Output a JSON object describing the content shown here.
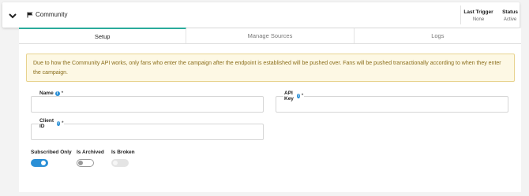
{
  "header": {
    "title": "Community",
    "last_trigger_label": "Last Trigger",
    "last_trigger_value": "None",
    "status_label": "Status",
    "status_value": "Active"
  },
  "tabs": [
    {
      "label": "Setup",
      "active": true
    },
    {
      "label": "Manage Sources",
      "active": false
    },
    {
      "label": "Logs",
      "active": false
    }
  ],
  "notice": "Due to how the Community API works, only fans who enter the campaign after the endpoint is established will be pushed over. Fans will be pushed transactionally according to when they enter the campaign.",
  "fields": {
    "name": {
      "label": "Name",
      "required": "*",
      "value": ""
    },
    "api_key": {
      "label": "API Key",
      "required": "*",
      "value": ""
    },
    "client_id": {
      "label": "Client ID",
      "required": "*",
      "value": ""
    }
  },
  "toggles": {
    "subscribed_only": {
      "label": "Subscribed Only",
      "on": true
    },
    "is_archived": {
      "label": "Is Archived",
      "on": false
    },
    "is_broken": {
      "label": "Is Broken",
      "on": false,
      "disabled": true
    }
  },
  "colors": {
    "accent": "#2a8fd6",
    "tab_active": "#2aab9b",
    "notice_bg": "#fdf8e4",
    "notice_text": "#8a6d1a"
  }
}
